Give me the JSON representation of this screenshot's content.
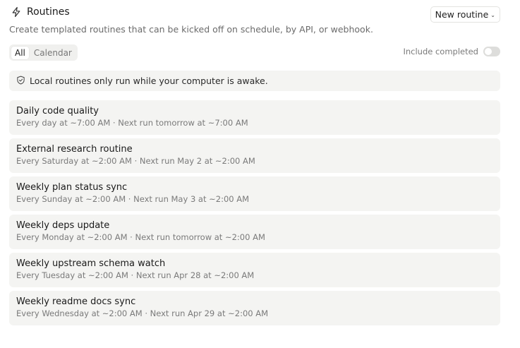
{
  "header": {
    "title": "Routines",
    "new_button_label": "New routine",
    "subtitle": "Create templated routines that can be kicked off on schedule, by API, or webhook."
  },
  "tabs": [
    {
      "label": "All",
      "active": true
    },
    {
      "label": "Calendar",
      "active": false
    }
  ],
  "include_completed": {
    "label": "Include completed",
    "on": false
  },
  "notice": {
    "text": "Local routines only run while your computer is awake.",
    "icon": "shield-icon"
  },
  "routines": [
    {
      "name": "Daily code quality",
      "schedule": "Every day at ~7:00 AM · Next run tomorrow at ~7:00 AM"
    },
    {
      "name": "External research routine",
      "schedule": "Every Saturday at ~2:00 AM · Next run May 2 at ~2:00 AM"
    },
    {
      "name": "Weekly plan status sync",
      "schedule": "Every Sunday at ~2:00 AM · Next run May 3 at ~2:00 AM"
    },
    {
      "name": "Weekly deps update",
      "schedule": "Every Monday at ~2:00 AM · Next run tomorrow at ~2:00 AM"
    },
    {
      "name": "Weekly upstream schema watch",
      "schedule": "Every Tuesday at ~2:00 AM · Next run Apr 28 at ~2:00 AM"
    },
    {
      "name": "Weekly readme docs sync",
      "schedule": "Every Wednesday at ~2:00 AM · Next run Apr 29 at ~2:00 AM"
    }
  ],
  "colors": {
    "row_bg": "#f4f4f2",
    "muted_text": "#7a7a7a"
  }
}
